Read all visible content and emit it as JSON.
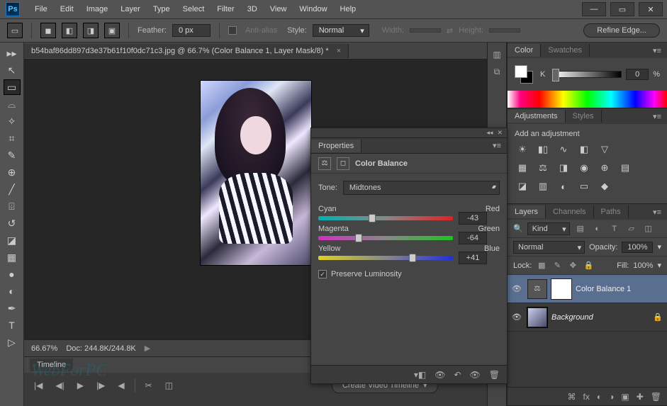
{
  "app": "Ps",
  "menu": [
    "File",
    "Edit",
    "Image",
    "Layer",
    "Type",
    "Select",
    "Filter",
    "3D",
    "View",
    "Window",
    "Help"
  ],
  "optbar": {
    "feather_label": "Feather:",
    "feather_value": "0 px",
    "antialias_label": "Anti-alias",
    "style_label": "Style:",
    "style_value": "Normal",
    "width_label": "Width:",
    "height_label": "Height:",
    "refine_btn": "Refine Edge..."
  },
  "tab": {
    "title": "b54baf86dd897d3e37b61f10f0dc71c3.jpg @ 66.7%  (Color Balance 1, Layer Mask/8) *"
  },
  "status": {
    "zoom": "66.67%",
    "docinfo": "Doc: 244.8K/244.8K"
  },
  "timeline": {
    "tab": "Timeline",
    "create_btn": "Create Video Timeline"
  },
  "properties": {
    "tab": "Properties",
    "header": "Color Balance",
    "tone_label": "Tone:",
    "tone_value": "Midtones",
    "rows": [
      {
        "l": "Cyan",
        "r": "Red",
        "val": "-43",
        "pos": 40
      },
      {
        "l": "Magenta",
        "r": "Green",
        "val": "-64",
        "pos": 30
      },
      {
        "l": "Yellow",
        "r": "Blue",
        "val": "+41",
        "pos": 70
      }
    ],
    "preserve_label": "Preserve Luminosity"
  },
  "color": {
    "tab": "Color",
    "tab2": "Swatches",
    "k_label": "K",
    "k_val": "0",
    "k_pct": "%"
  },
  "adjustments": {
    "tab": "Adjustments",
    "tab2": "Styles",
    "title": "Add an adjustment"
  },
  "layers": {
    "tabs": [
      "Layers",
      "Channels",
      "Paths"
    ],
    "kind": "Kind",
    "blend": "Normal",
    "opacity_label": "Opacity:",
    "opacity": "100%",
    "lock_label": "Lock:",
    "fill_label": "Fill:",
    "fill": "100%",
    "items": [
      {
        "name": "Color Balance 1",
        "sel": true,
        "type": "adj"
      },
      {
        "name": "Background",
        "sel": false,
        "type": "img",
        "locked": true
      }
    ]
  },
  "watermark": "WebForPC"
}
